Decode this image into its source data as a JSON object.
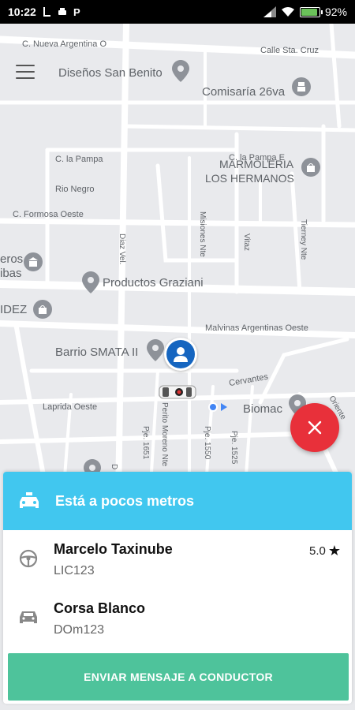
{
  "status_bar": {
    "time": "10:22",
    "battery": "92",
    "battery_level": 0.92
  },
  "map": {
    "labels": {
      "nueva_argentina": "C. Nueva Argentina O",
      "calle_sta_cruz": "Calle Sta. Cruz",
      "disenos_san_benito": "Diseños San Benito",
      "comisaria": "Comisaría 26va",
      "la_pampa": "C. la Pampa",
      "la_pampa_e": "C. la Pampa E",
      "marmoleria": "MARMOLERIA",
      "los_hermanos": "LOS HERMANOS",
      "rio_negro": "Rio Negro",
      "formosa": "C. Formosa Oeste",
      "eros": "eros",
      "ibas": "ibas",
      "productos_graziani": "Productos Graziani",
      "idez": "IDEZ",
      "malvinas": "Malvinas Argentinas Oeste",
      "barrio_smata": "Barrio SMATA II",
      "cervantes": "Cervantes",
      "laprida": "Laprida Oeste",
      "biomac": "Biomac",
      "diaz_vel": "Diaz Vel.",
      "misiones": "Misiones Nte",
      "vitaz": "Vitaz",
      "tierney": "Tierney Nte",
      "perito_moreno": "Perito Moreno Nte",
      "pje_1651": "Pje. 1651",
      "pje_1550": "Pje. 1550",
      "pje_1525": "Pje. 1525",
      "oriente": "Oriente",
      "d_label": "D"
    }
  },
  "trip": {
    "status_title": "Está a pocos metros",
    "driver_name": "Marcelo Taxinube",
    "driver_license": "LIC123",
    "rating": "5.0",
    "vehicle_name": "Corsa Blanco",
    "vehicle_plate": "DOm123",
    "send_message_label": "ENVIAR MENSAJE A CONDUCTOR"
  },
  "colors": {
    "header_blue": "#41c7ef",
    "button_green": "#4ec39b",
    "close_red": "#e8303a",
    "user_blue": "#1565c0"
  }
}
